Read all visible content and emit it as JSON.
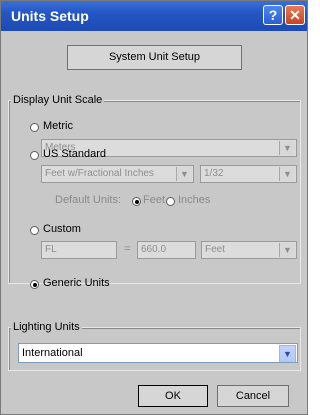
{
  "window": {
    "title": "Units Setup",
    "help_glyph": "?",
    "close_glyph": "✕"
  },
  "system_unit_button": "System Unit Setup",
  "display_unit_scale": {
    "label": "Display Unit Scale",
    "metric": {
      "label": "Metric",
      "selected": false,
      "dropdown_value": "Meters"
    },
    "us_standard": {
      "label": "US Standard",
      "selected": false,
      "dropdown_value": "Feet w/Fractional Inches",
      "fraction_value": "1/32",
      "default_units_label": "Default Units:",
      "feet_label": "Feet",
      "inches_label": "Inches"
    },
    "custom": {
      "label": "Custom",
      "selected": false,
      "name_value": "FL",
      "equals": "=",
      "amount_value": "660.0",
      "unit_value": "Feet"
    },
    "generic": {
      "label": "Generic Units",
      "selected": true
    }
  },
  "lighting_units": {
    "label": "Lighting Units",
    "value": "International"
  },
  "buttons": {
    "ok": "OK",
    "cancel": "Cancel"
  },
  "icons": {
    "dropdown_arrow": "▼"
  }
}
